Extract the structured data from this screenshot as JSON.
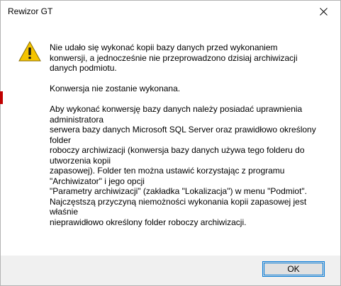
{
  "window": {
    "title": "Rewizor GT"
  },
  "message": {
    "paragraph1": [
      "Nie udało się wykonać kopii bazy danych przed wykonaniem",
      "konwersji, a jednocześnie nie przeprowadzono dzisiaj archiwizacji",
      "danych podmiotu."
    ],
    "paragraph2": [
      "Konwersja nie zostanie wykonana."
    ],
    "paragraph3": [
      "Aby wykonać konwersję bazy danych należy posiadać uprawnienia",
      "administratora",
      "serwera bazy danych Microsoft SQL Server oraz prawidłowo określony",
      "folder",
      "roboczy archiwizacji (konwersja bazy danych używa tego folderu do",
      "utworzenia kopii",
      "zapasowej). Folder ten można ustawić korzystając z programu",
      "\"Archiwizator\" i jego opcji",
      "\"Parametry archiwizacji\" (zakładka \"Lokalizacja\") w menu \"Podmiot\".",
      "Najczęstszą przyczyną niemożności wykonania kopii zapasowej jest",
      "właśnie",
      "nieprawidłowo określony folder roboczy archiwizacji."
    ]
  },
  "buttons": {
    "ok_label": "OK"
  },
  "icons": {
    "warning": "warning-icon",
    "close": "close-icon"
  },
  "colors": {
    "warning_fill": "#f5c400",
    "focus_border": "#0078d7",
    "footer_bg": "#f0f0f0"
  }
}
